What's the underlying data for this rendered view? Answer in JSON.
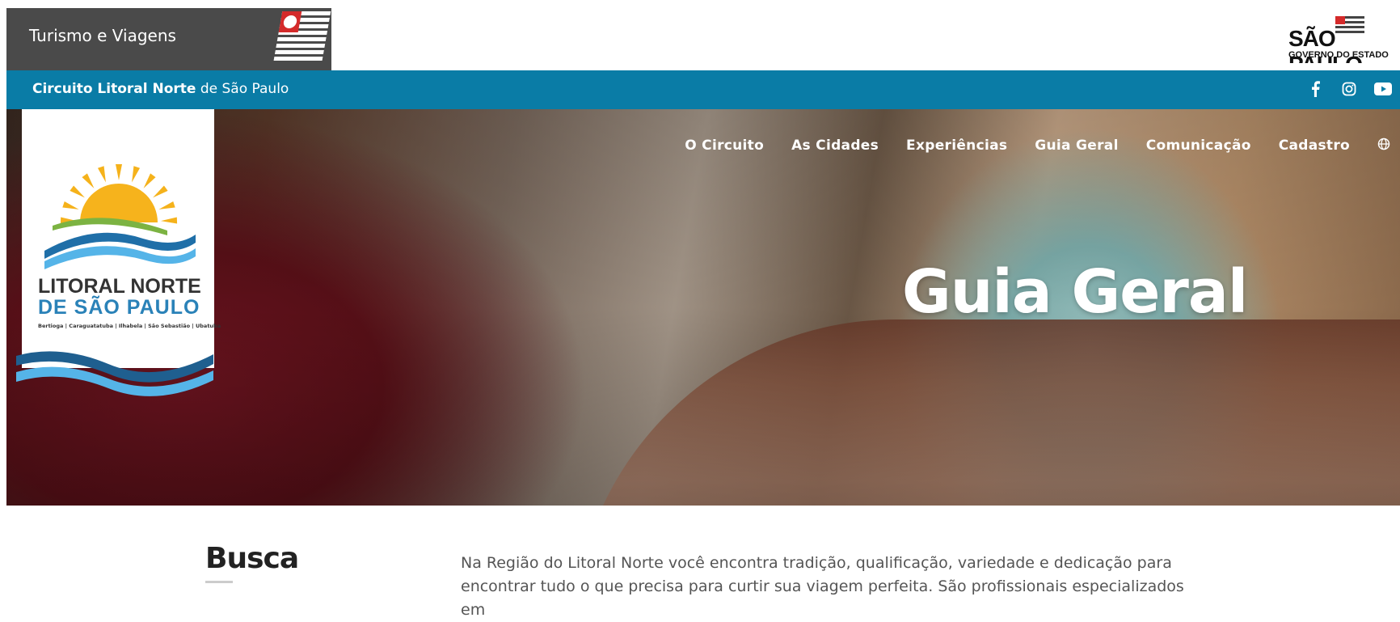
{
  "gov_bar": {
    "title": "Turismo e Viagens",
    "brand_line1": "SÃO PAULO",
    "brand_line2": "GOVERNO DO ESTADO"
  },
  "circuit_bar": {
    "bold": "Circuito Litoral Norte",
    "rest": " de São Paulo"
  },
  "logo": {
    "line1": "LITORAL NORTE",
    "line2": "DE SÃO PAULO",
    "cities": "Bertioga | Caraguatatuba | Ilhabela | São Sebastião | Ubatuba"
  },
  "nav": {
    "items": [
      "O Circuito",
      "As Cidades",
      "Experiências",
      "Guia Geral",
      "Comunicação",
      "Cadastro"
    ]
  },
  "hero": {
    "title": "Guia Geral"
  },
  "section": {
    "heading": "Busca",
    "intro": "Na Região do Litoral Norte você encontra tradição, qualificação, variedade e dedicação para encontrar tudo o que precisa para curtir sua viagem perfeita. São profissionais especializados em"
  },
  "colors": {
    "blue_bar": "#0a7ca6",
    "gov_gray": "#4a4a4a"
  },
  "icons": [
    "facebook-icon",
    "instagram-icon",
    "youtube-icon",
    "globe-icon"
  ]
}
